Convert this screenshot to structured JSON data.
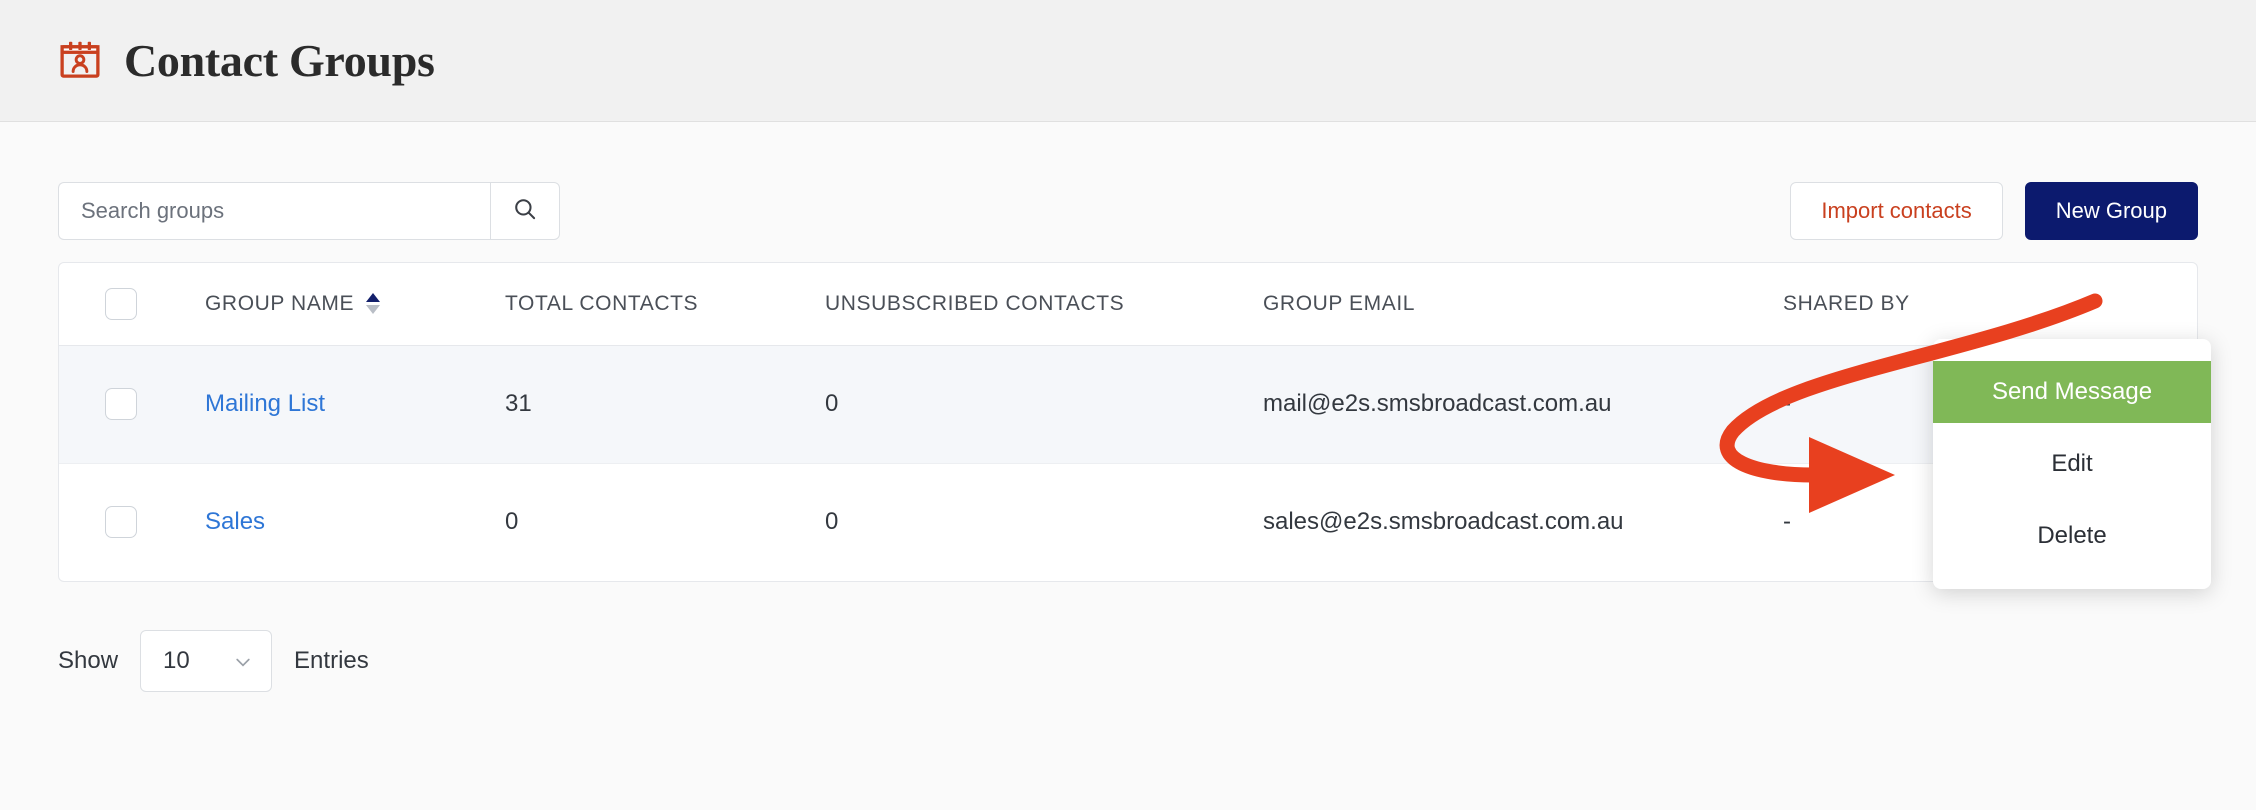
{
  "header": {
    "title": "Contact Groups",
    "icon": "contact-card-icon",
    "icon_color": "#c9401f",
    "band_color": "#f1f1f1"
  },
  "toolbar": {
    "search": {
      "placeholder": "Search groups",
      "value": "",
      "button_icon": "search-icon"
    },
    "import_label": "Import contacts",
    "new_group_label": "New Group",
    "import_color": "#c9401f",
    "new_group_bg": "#0c1a6e"
  },
  "table": {
    "columns": [
      {
        "key": "checkbox",
        "label": ""
      },
      {
        "key": "name",
        "label": "GROUP NAME",
        "sorted": "asc"
      },
      {
        "key": "total",
        "label": "TOTAL CONTACTS"
      },
      {
        "key": "unsub",
        "label": "UNSUBSCRIBED CONTACTS"
      },
      {
        "key": "email",
        "label": "GROUP EMAIL"
      },
      {
        "key": "shared",
        "label": "SHARED BY"
      },
      {
        "key": "menu",
        "label": ""
      }
    ],
    "rows": [
      {
        "name": "Mailing List",
        "total": "31",
        "unsubscribed": "0",
        "email": "mail@e2s.smsbroadcast.com.au",
        "shared_by": "-"
      },
      {
        "name": "Sales",
        "total": "0",
        "unsubscribed": "0",
        "email": "sales@e2s.smsbroadcast.com.au",
        "shared_by": "-"
      }
    ]
  },
  "row_menu": {
    "open_for_row": "Mailing List",
    "items": [
      {
        "label": "Send Message",
        "highlighted": true
      },
      {
        "label": "Edit",
        "highlighted": false
      },
      {
        "label": "Delete",
        "highlighted": false
      }
    ],
    "highlight_color": "#80b857"
  },
  "annotation": {
    "type": "curved-arrow",
    "color": "#e8401f",
    "points_to": "Send Message"
  },
  "footer": {
    "show_label": "Show",
    "entries_value": "10",
    "entries_label": "Entries",
    "dropdown_icon": "chevron-down-icon"
  }
}
